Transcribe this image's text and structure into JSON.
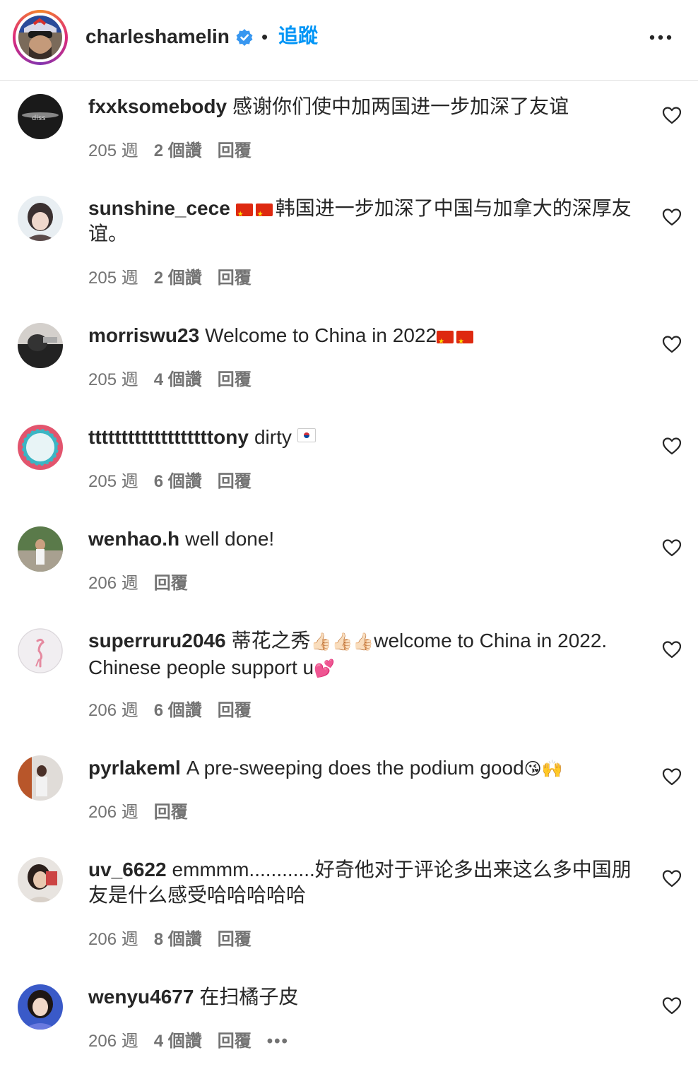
{
  "header": {
    "username": "charleshamelin",
    "separator": "•",
    "follow_label": "追蹤",
    "more_icon": "more-horizontal-icon",
    "verified_icon": "verified-badge-icon",
    "colors": {
      "follow": "#0095f6",
      "verified": "#3897f0"
    }
  },
  "comments": [
    {
      "username": "fxxksomebody",
      "text": "感谢你们使中加两国进一步加深了友谊",
      "time": "205 週",
      "likes": "2 個讚",
      "reply": "回覆"
    },
    {
      "username": "sunshine_cece",
      "text": "韩国进一步加深了中国与加拿大的深厚友谊。",
      "time": "205 週",
      "likes": "2 個讚",
      "reply": "回覆"
    },
    {
      "username": "morriswu23",
      "text": "Welcome to China in 2022",
      "time": "205 週",
      "likes": "4 個讚",
      "reply": "回覆"
    },
    {
      "username": "tttttttttttttttttttony",
      "text": "dirty",
      "time": "205 週",
      "likes": "6 個讚",
      "reply": "回覆"
    },
    {
      "username": "wenhao.h",
      "text": "well done!",
      "time": "206 週",
      "likes": "",
      "reply": "回覆"
    },
    {
      "username": "superruru2046",
      "text_a": "蒂花之秀",
      "text_b": "welcome to China in 2022. Chinese people support u",
      "time": "206 週",
      "likes": "6 個讚",
      "reply": "回覆"
    },
    {
      "username": "pyrlakeml",
      "text": "A pre-sweeping does the podium good",
      "time": "206 週",
      "likes": "",
      "reply": "回覆"
    },
    {
      "username": "uv_6622",
      "text": "emmmm............好奇他对于评论多出来这么多中国朋友是什么感受哈哈哈哈哈",
      "time": "206 週",
      "likes": "8 個讚",
      "reply": "回覆"
    },
    {
      "username": "wenyu4677",
      "text": "在扫橘子皮",
      "time": "206 週",
      "likes": "4 個讚",
      "reply": "回覆",
      "more": "•••"
    }
  ]
}
